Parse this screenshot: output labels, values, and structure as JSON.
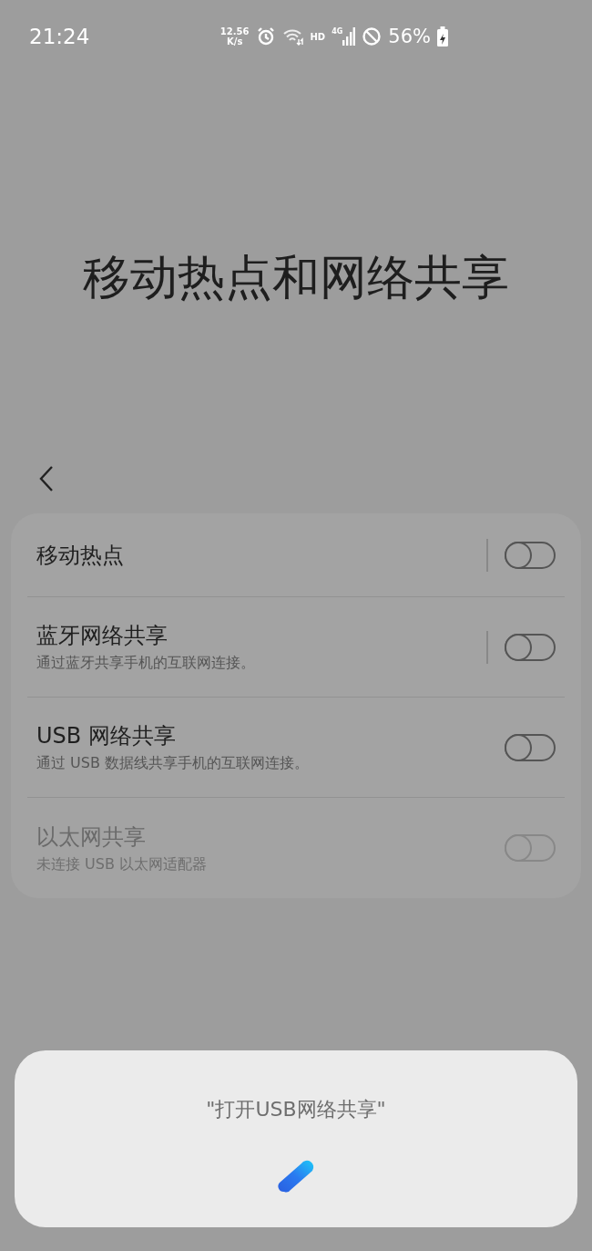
{
  "status_bar": {
    "time": "21:24",
    "net_speed": "12.56",
    "net_unit": "K/s",
    "network_label": "HD",
    "signal_label": "4G",
    "battery": "56%"
  },
  "title": "移动热点和网络共享",
  "items": [
    {
      "kind": "split",
      "title": "移动热点",
      "on": false,
      "disabled": false
    },
    {
      "kind": "split",
      "title": "蓝牙网络共享",
      "subtitle": "通过蓝牙共享手机的互联网连接。",
      "on": false,
      "disabled": false
    },
    {
      "kind": "plain",
      "title": "USB 网络共享",
      "subtitle": "通过 USB 数据线共享手机的互联网连接。",
      "on": false,
      "disabled": false
    },
    {
      "kind": "plain",
      "title": "以太网共享",
      "subtitle": "未连接 USB 以太网适配器",
      "on": false,
      "disabled": true
    }
  ],
  "voice_dialog": {
    "utterance": "\"打开USB网络共享\""
  }
}
